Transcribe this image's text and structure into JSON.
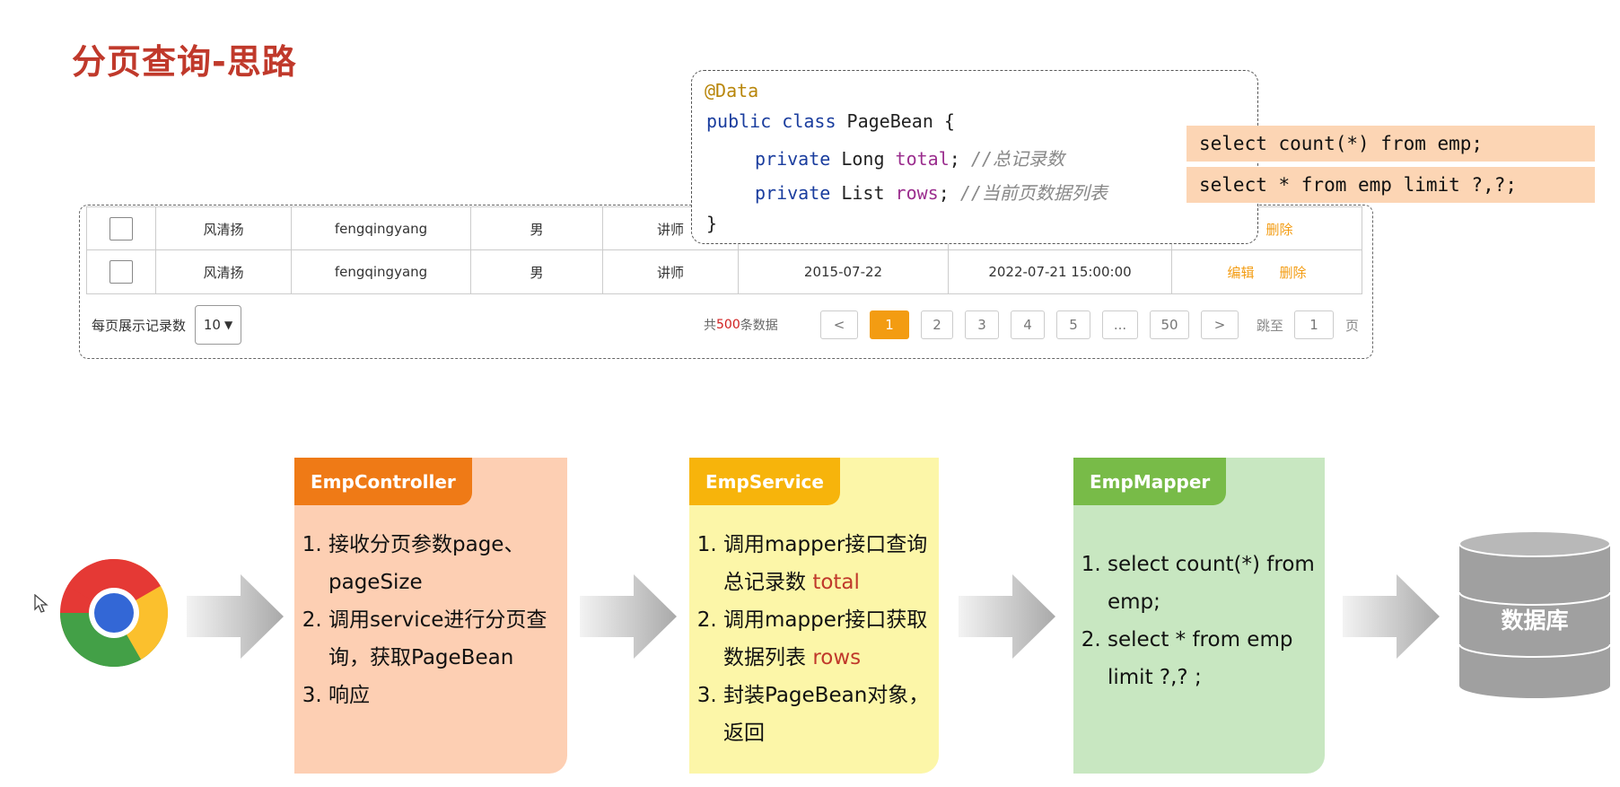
{
  "title": "分页查询-思路",
  "table": {
    "rows": [
      {
        "name": "风清扬",
        "username": "fengqingyang",
        "gender": "男",
        "job": "讲师",
        "entry_date": "",
        "update_time": "",
        "edit": "",
        "delete": "删除"
      },
      {
        "name": "风清扬",
        "username": "fengqingyang",
        "gender": "男",
        "job": "讲师",
        "entry_date": "2015-07-22",
        "update_time": "2022-07-21 15:00:00",
        "edit": "编辑",
        "delete": "删除"
      }
    ]
  },
  "pagination": {
    "page_size_label": "每页展示记录数",
    "page_size_value": "10",
    "total_prefix": "共",
    "total_count": "500",
    "total_suffix": "条数据",
    "prev": "<",
    "pages": [
      "1",
      "2",
      "3",
      "4",
      "5",
      "...",
      "50"
    ],
    "next": ">",
    "jump_label": "跳至",
    "jump_value": "1",
    "page_unit": "页"
  },
  "code": {
    "line1": "@Data",
    "line2_kw": "public class",
    "line2_rest": " PageBean {",
    "line3_kw": "private",
    "line3_type": " Long ",
    "line3_field": "total",
    "line3_semi": "; ",
    "line3_comment": "//总记录数",
    "line4_kw": "private",
    "line4_type": " List ",
    "line4_field": "rows",
    "line4_semi": "; ",
    "line4_comment": "//当前页数据列表",
    "line5": "}"
  },
  "sql": [
    "select count(*) from emp;",
    "select * from emp limit ?,?;"
  ],
  "flow": {
    "controller": {
      "title": "EmpController",
      "items": [
        [
          "接收分页参数page、pageSize",
          ""
        ],
        [
          "调用service进行分页查询，获取PageBean",
          ""
        ],
        [
          "响应",
          ""
        ]
      ]
    },
    "service": {
      "title": "EmpService",
      "items": [
        [
          "调用mapper接口查询总记录数",
          "total"
        ],
        [
          "调用mapper接口获取数据列表",
          "rows"
        ],
        [
          "封装PageBean对象，返回",
          ""
        ]
      ]
    },
    "mapper": {
      "title": "EmpMapper",
      "items": [
        [
          "select count(*) from emp;",
          ""
        ],
        [
          "select * from emp limit ?,? ;",
          ""
        ]
      ]
    },
    "database": "数据库"
  },
  "colors": {
    "controller_bg": "#fdcfb3",
    "controller_hdr": "#ef7a16",
    "service_bg": "#fcf6a8",
    "service_hdr": "#f7b40b",
    "mapper_bg": "#c8e7c1",
    "mapper_hdr": "#78bb48"
  }
}
